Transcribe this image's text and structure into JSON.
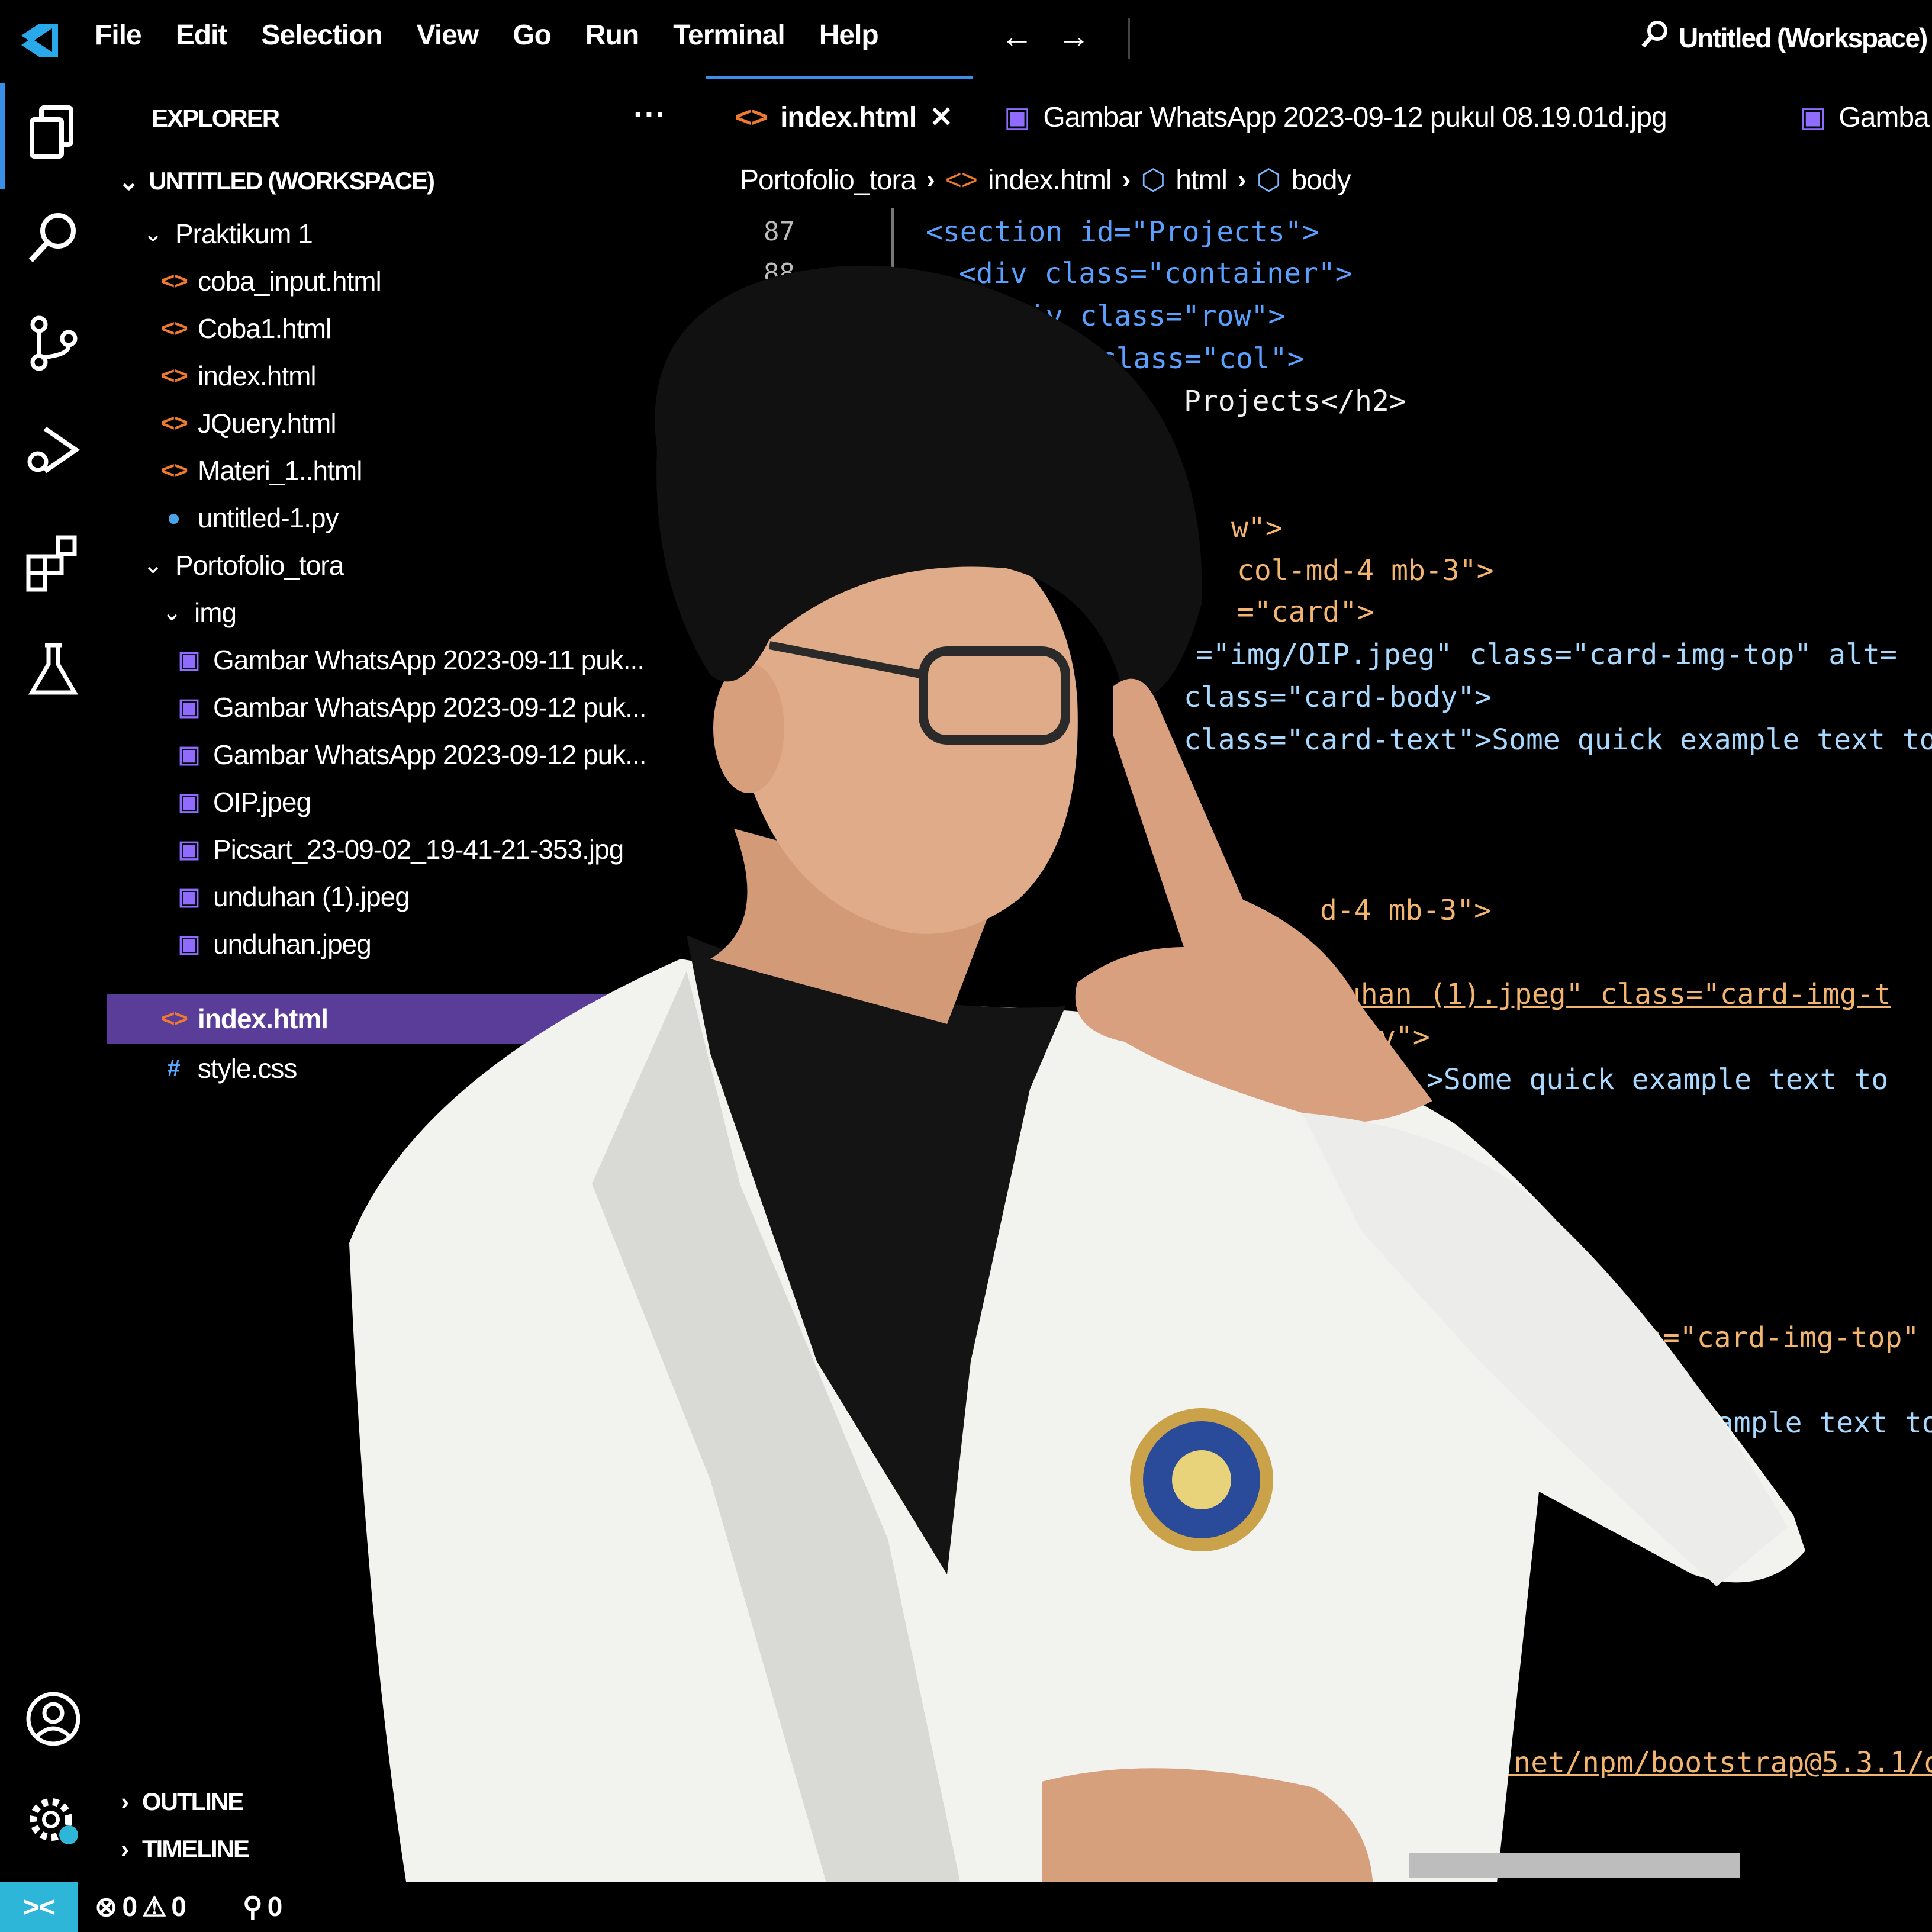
{
  "menubar": {
    "items": [
      "File",
      "Edit",
      "Selection",
      "View",
      "Go",
      "Run",
      "Terminal",
      "Help"
    ],
    "back_arrow": "←",
    "forward_arrow": "→",
    "window_title": "Untitled (Workspace)"
  },
  "explorer": {
    "header": "EXPLORER",
    "more": "···",
    "workspace": "UNTITLED (WORKSPACE)",
    "folders": [
      {
        "name": "Praktikum 1",
        "files": [
          "coba_input.html",
          "Coba1.html",
          "index.html",
          "JQuery.html",
          "Materi_1..html",
          "untitled-1.py"
        ]
      },
      {
        "name": "Portofolio_tora",
        "subfolder": "img",
        "images": [
          "Gambar WhatsApp 2023-09-11 puk...",
          "Gambar WhatsApp 2023-09-12 puk...",
          "Gambar WhatsApp 2023-09-12 puk...",
          "OIP.jpeg",
          "Picsart_23-09-02_19-41-21-353.jpg",
          "unduhan (1).jpeg",
          "unduhan.jpeg"
        ],
        "files": [
          "index.html",
          "style.css"
        ]
      }
    ],
    "outline": "OUTLINE",
    "timeline": "TIMELINE"
  },
  "tabs": [
    {
      "label": "index.html",
      "active": true,
      "close": "✕"
    },
    {
      "label": "Gambar WhatsApp 2023-09-12 pukul 08.19.01d.jpg",
      "active": false
    },
    {
      "label": "Gamba",
      "active": false
    }
  ],
  "breadcrumb": [
    "Portofolio_tora",
    "index.html",
    "html",
    "body"
  ],
  "code": {
    "line_numbers": [
      "87",
      "88"
    ],
    "lines": [
      "<section id=\"Projects\">",
      "<div class=\"container\">",
      "<div class=\"row\">",
      "iv class=\"col\">",
      "Projects</h2>",
      "w\">",
      "col-md-4 mb-3\">",
      "=\"card\">",
      "=\"img/OIP.jpeg\" class=\"card-img-top\" alt=",
      "class=\"card-body\">",
      "class=\"card-text\">Some quick example text to",
      "d-4 mb-3\">",
      "uhan (1).jpeg\" class=\"card-img-t",
      "dy\">",
      ">Some quick example text to",
      "s=\"card-img-top\"",
      "ample text to",
      "delivr.net/npm/bootstrap@5.3.1/d"
    ]
  },
  "statusbar": {
    "remote_icon": "><",
    "errors": "0",
    "warnings": "0",
    "ports": "0"
  },
  "colors": {
    "accent": "#3c8fe6",
    "selection": "#5a3d99",
    "html_icon": "#f07a2c",
    "image_icon": "#8f6cff",
    "tag": "#5aa0ff",
    "string": "#f2b46e",
    "remote": "#2eb6d8"
  }
}
